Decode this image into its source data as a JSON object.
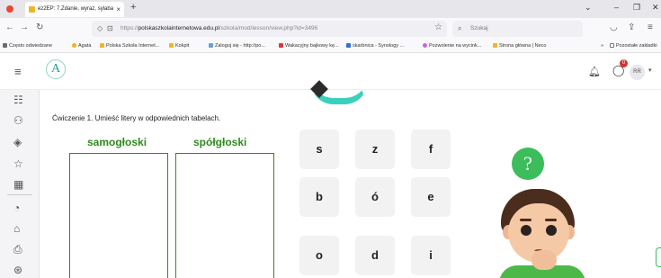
{
  "browser": {
    "tab_title": "ez2EP: 7.Zdanie, wyraz, sylaba",
    "tab_close": "×",
    "new_tab": "+",
    "url_prefix": "https://",
    "url_domain": "polskaszkolainternetowa.edu.pl",
    "url_path": "/szkola/mod/lesson/view.php?id=3496",
    "search_placeholder": "Szukaj",
    "bookmarks": [
      "Często odwiedzane",
      "Agata",
      "Polska Szkoła Internet...",
      "Kokpit",
      "Zaloguj się - http://po...",
      "Wakacyjny bajkowy kę...",
      "skarbnica - Synology ...",
      "Pozwolenie na wycink...",
      "Strona główna | Neco"
    ],
    "bookmarks_overflow": "»",
    "other_bookmarks": "Pozostałe zakładki"
  },
  "app": {
    "logo_letter": "A",
    "notification_count": "0",
    "user_initials": "RR"
  },
  "exercise": {
    "instruction": "Ćwiczenie 1. Umieść litery w odpowiednich tabelach.",
    "column_vowels": "samogłoski",
    "column_consonants": "spółgłoski",
    "tiles": [
      "s",
      "z",
      "f",
      "b",
      "ó",
      "e",
      "o",
      "d",
      "i"
    ],
    "balloon_mark": "?"
  },
  "colors": {
    "accent_green": "#2e8b1e",
    "balloon_green": "#3cbc5a",
    "teal": "#3ad0bc",
    "badge_red": "#d0342c"
  }
}
